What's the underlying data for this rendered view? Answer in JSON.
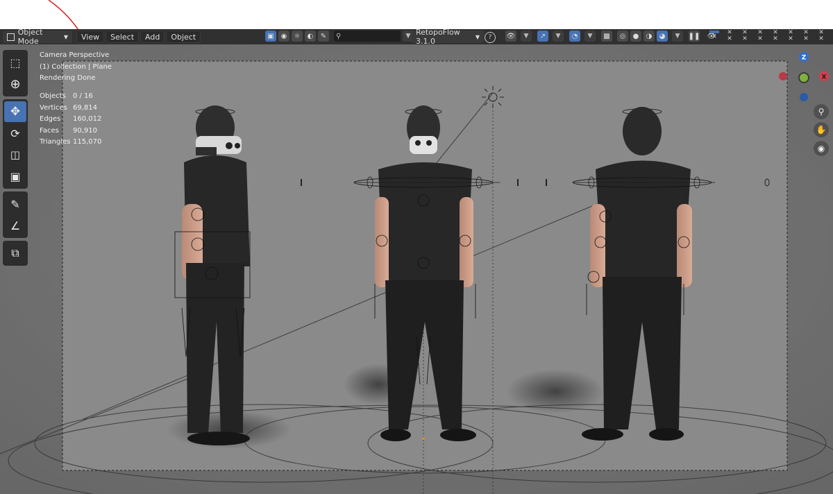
{
  "header": {
    "mode": "Object Mode",
    "menus": [
      "View",
      "Select",
      "Add",
      "Object"
    ],
    "addon": "RetopoFlow 3.1.0"
  },
  "viewport": {
    "view_name": "Camera Perspective",
    "collection": "(1) Collection | Plane",
    "status": "Rendering Done",
    "stats": [
      {
        "label": "Objects",
        "value": "0 / 16"
      },
      {
        "label": "Vertices",
        "value": "69,814"
      },
      {
        "label": "Edges",
        "value": "160,012"
      },
      {
        "label": "Faces",
        "value": "90,910"
      },
      {
        "label": "Triangles",
        "value": "115,070"
      }
    ]
  },
  "gizmo": {
    "z_label": "Z",
    "x_label": "X"
  },
  "icons": [
    "object-mode-icon",
    "select-box-icon",
    "cursor-icon",
    "move-icon",
    "rotate-icon",
    "scale-icon",
    "transform-icon",
    "annotate-icon",
    "measure-icon",
    "add-cube-icon",
    "zoom-icon",
    "hand-icon",
    "camera-icon"
  ],
  "colors": {
    "accent": "#4772b3",
    "header": "#303030",
    "viewport_bg": "#7d7d7d",
    "axis_x": "#d4404d",
    "axis_y": "#7fb23f",
    "axis_z": "#2f6fd0"
  }
}
